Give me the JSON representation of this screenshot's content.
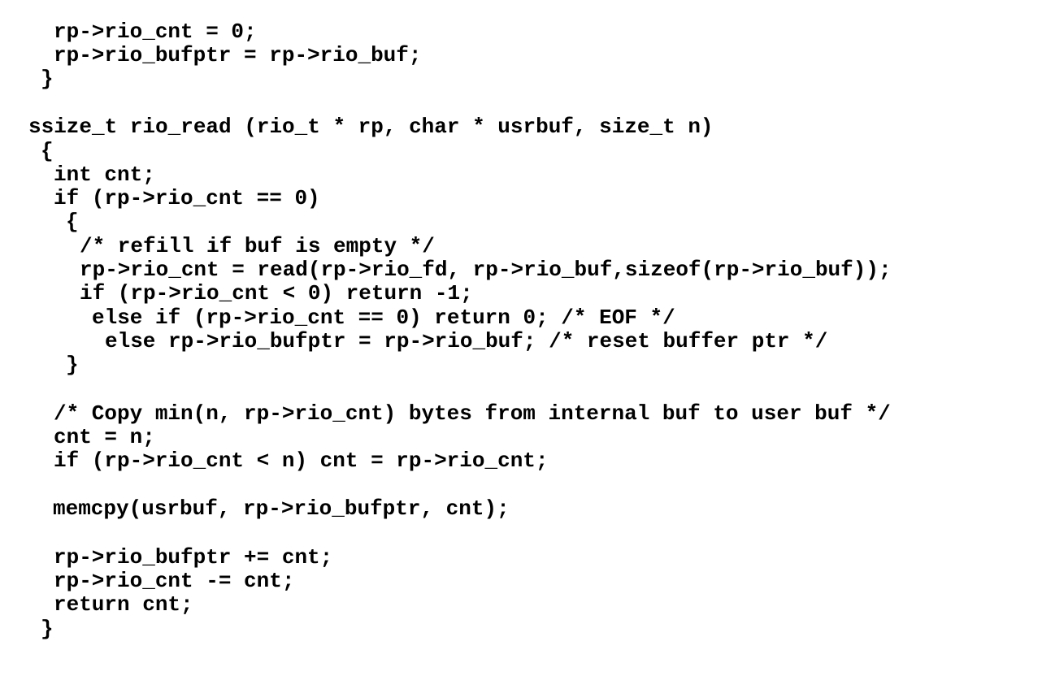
{
  "code": {
    "lines": [
      "rp->rio_cnt = 0;",
      "rp->rio_bufptr = rp->rio_buf;",
      "}",
      "ssize_t rio_read (rio_t * rp, char * usrbuf, size_t n)",
      "{",
      "int cnt;",
      "if (rp->rio_cnt == 0)",
      "{",
      "/* refill if buf is empty */",
      "rp->rio_cnt = read(rp->rio_fd, rp->rio_buf,sizeof(rp->rio_buf));",
      "if (rp->rio_cnt < 0) return -1;",
      "else if (rp->rio_cnt == 0) return 0; /* EOF */",
      "else rp->rio_bufptr = rp->rio_buf; /* reset buffer ptr */",
      "}",
      "/* Copy min(n, rp->rio_cnt) bytes from internal buf to user buf */",
      "cnt = n;",
      "if (rp->rio_cnt < n) cnt = rp->rio_cnt;",
      "memcpy(usrbuf, rp->rio_bufptr, cnt);",
      "rp->rio_bufptr += cnt;",
      "rp->rio_cnt -= cnt;",
      "return cnt;",
      "}"
    ]
  }
}
